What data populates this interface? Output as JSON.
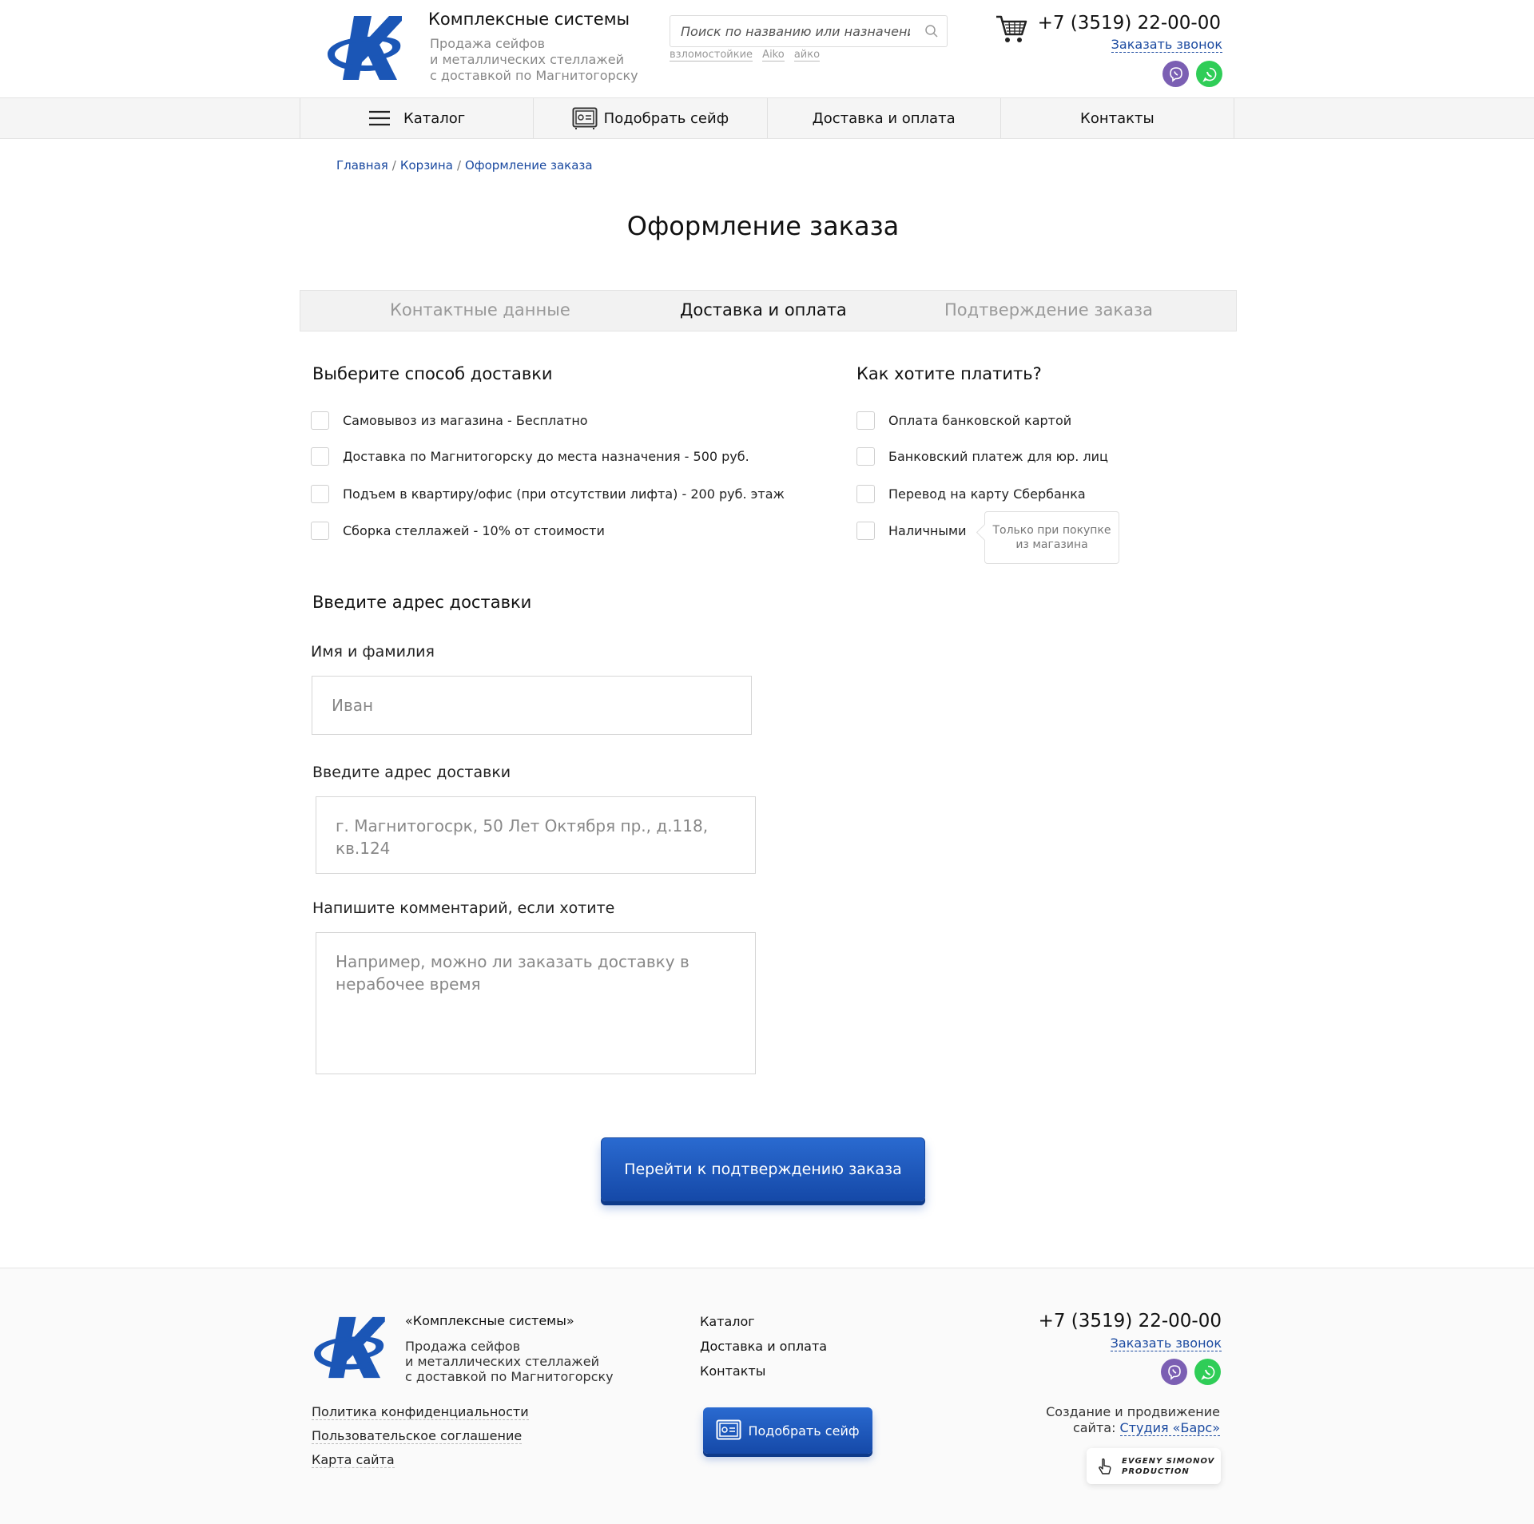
{
  "header": {
    "brand_title": "Комплексные системы",
    "brand_sub_1": "Продажа сейфов",
    "brand_sub_2": "и металлических стеллажей",
    "brand_sub_3": "с доставкой по Магнитогорску",
    "search_placeholder": "Поиск по названию или назначению",
    "search_tags": [
      "взломостойкие",
      "Aiko",
      "айко"
    ],
    "phone": "+7 (3519) 22-00-00",
    "callback": "Заказать звонок"
  },
  "nav": {
    "catalog": "Каталог",
    "pick_safe": "Подобрать сейф",
    "delivery": "Доставка и оплата",
    "contacts": "Контакты"
  },
  "breadcrumb": [
    "Главная",
    "Корзина",
    "Оформление заказа"
  ],
  "page_title": "Оформление заказа",
  "steps": [
    "Контактные данные",
    "Доставка и оплата",
    "Подтверждение заказа"
  ],
  "delivery": {
    "title": "Выберите способ доставки",
    "options": [
      "Самовывоз из магазина - Бесплатно",
      "Доставка по Магнитогорску до места назначения - 500 руб.",
      "Подъем в квартиру/офис (при отсутствии лифта) - 200 руб. этаж",
      "Сборка стеллажей - 10% от стоимости"
    ]
  },
  "payment": {
    "title": "Как хотите платить?",
    "options": [
      "Оплата банковской картой",
      "Банковский платеж для юр. лиц",
      "Перевод на карту Сбербанка",
      "Наличными"
    ],
    "tooltip_1": "Только при покупке",
    "tooltip_2": "из магазина"
  },
  "address": {
    "title": "Введите адрес доставки",
    "name_label": "Имя и фамилия",
    "name_placeholder": "Иван",
    "address_label": "Введите адрес доставки",
    "address_placeholder": "г. Магнитогосрк, 50 Лет Октября пр., д.118, кв.124",
    "comment_label": "Напишите комментарий, если хотите",
    "comment_placeholder": "Например, можно ли заказать доставку в нерабочее время"
  },
  "submit_label": "Перейти к подтверждению заказа",
  "footer": {
    "brand_title": "«Комплексные системы»",
    "brand_sub_1": "Продажа сейфов",
    "brand_sub_2": "и металлических стеллажей",
    "brand_sub_3": "с доставкой по Магнитогорску",
    "links": [
      "Политика конфиденциальности",
      "Пользовательское соглашение",
      "Карта сайта"
    ],
    "nav": [
      "Каталог",
      "Доставка и оплата",
      "Контакты"
    ],
    "pick_safe": "Подобрать сейф",
    "phone": "+7 (3519) 22-00-00",
    "callback": "Заказать звонок",
    "credit_1": "Создание и продвижение",
    "credit_2": "сайта:",
    "credit_studio": "Студия «Барс»",
    "badge_1": "EVGENY SIMONOV",
    "badge_2": "PRODUCTION"
  },
  "colors": {
    "accent": "#1b4aa0",
    "button": "#1f5bc0",
    "viber": "#7b5fb3",
    "whatsapp": "#2fcd57"
  },
  "icons": [
    "logo-k-icon",
    "search-icon",
    "cart-icon",
    "viber-icon",
    "whatsapp-icon",
    "menu-icon",
    "safe-icon",
    "pointer-hand-icon"
  ]
}
